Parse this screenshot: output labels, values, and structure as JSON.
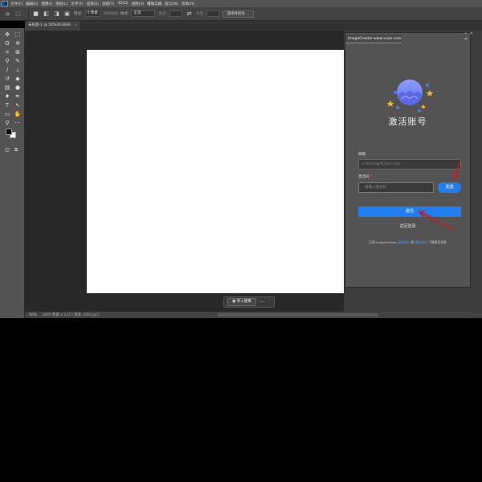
{
  "menu": {
    "app_logo": "Ps",
    "items": [
      "文件(F)",
      "编辑(E)",
      "图像(I)",
      "图层(L)",
      "文字(Y)",
      "选择(S)",
      "滤镜(T)",
      "3D(D)",
      "视图(V)",
      "增效工具",
      "窗口(W)",
      "帮助(H)"
    ]
  },
  "options": {
    "feather_label": "羽化:",
    "feather_value": "0 像素",
    "antialias_label": "消除锯齿",
    "style_label": "样式:",
    "style_value": "正常",
    "width_label": "宽度:",
    "height_label": "高度:",
    "select_subject_btn": "选择并遮住 ..."
  },
  "document": {
    "tab_title": "未标题-1 @ 50%(RGB/8)"
  },
  "context_bar": {
    "import_label": "导入图像",
    "more_label": "···"
  },
  "status": {
    "zoom": "50%",
    "doc_size": "1890 像素 x 1417 像素 (300 ppi)"
  },
  "panel": {
    "tab_title": "ImageCreator-www.xxjm.com",
    "heading": "激活账号",
    "email_label": "邮箱",
    "email_value": "x?#xbx@#j5ym.com",
    "code_label": "激活码",
    "code_required": "*",
    "code_placeholder": "请输入激活码",
    "send_label": "发送",
    "activate_label": "激活",
    "back_label": "返回登录",
    "footer_prefix": "已同 ImageCreator",
    "footer_link1": "使用协议",
    "footer_sep": "和",
    "footer_link2": "隐私协议",
    "footer_suffix": "了解更多信息",
    "collapse_icon": "«",
    "close_icon": "×",
    "menu_icon": "≡"
  },
  "colors": {
    "accent": "#1e7ef2",
    "annotation": "#cc1a1a",
    "logo_planet": "#7b8cff",
    "logo_star_gold": "#f3b63a",
    "logo_star_blue": "#4d7cff"
  }
}
